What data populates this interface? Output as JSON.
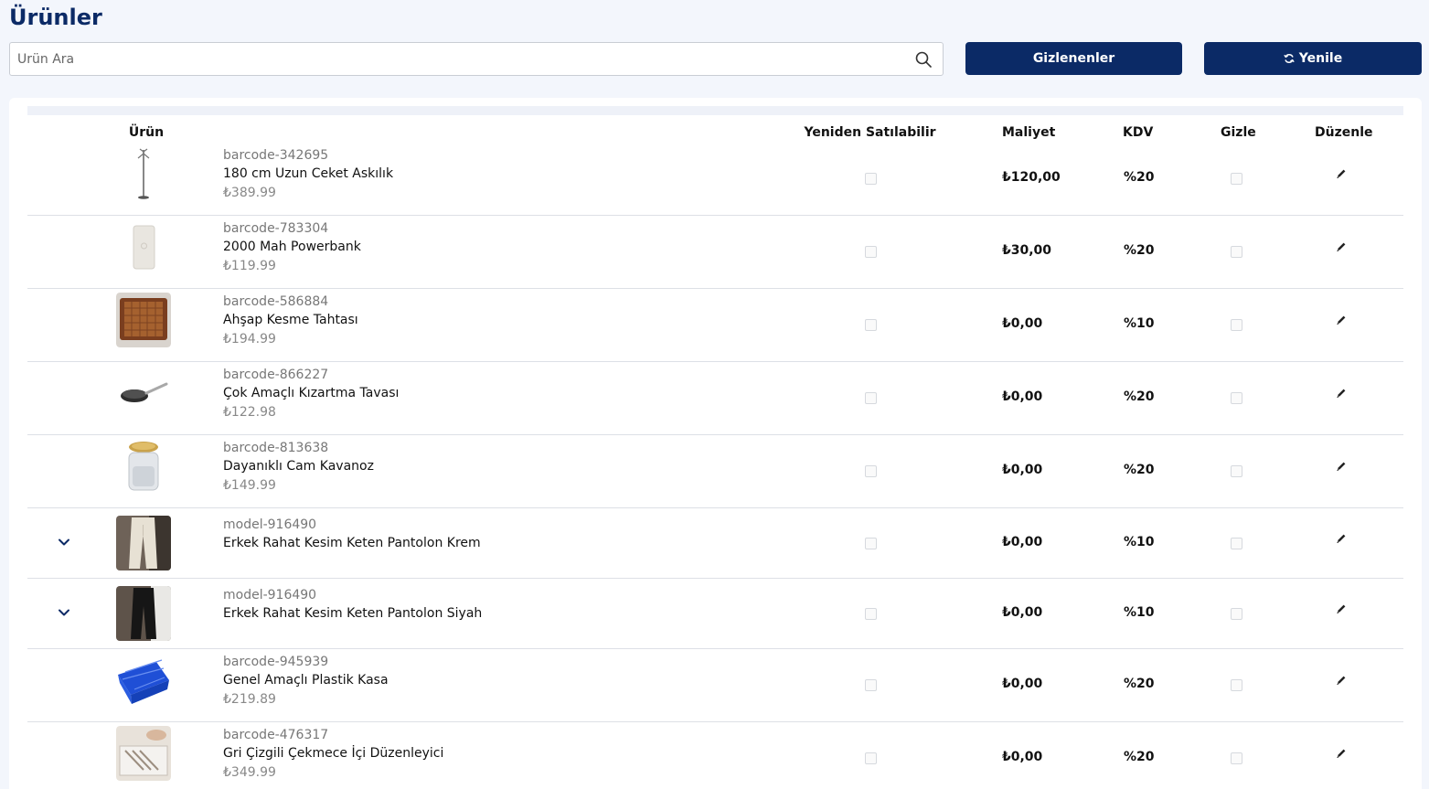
{
  "page": {
    "title": "Ürünler"
  },
  "search": {
    "placeholder": "Ürün Ara"
  },
  "buttons": {
    "hidden_label": "Gizlenenler",
    "refresh_label": "Yenile"
  },
  "table": {
    "headers": {
      "product": "Ürün",
      "resellable": "Yeniden Satılabilir",
      "cost": "Maliyet",
      "vat": "KDV",
      "hide": "Gizle",
      "edit": "Düzenle"
    },
    "rows": [
      {
        "code": "barcode-342695",
        "name": "180 cm Uzun Ceket Askılık",
        "price": "₺389.99",
        "cost": "₺120,00",
        "vat": "%20",
        "image": "coat-rack"
      },
      {
        "code": "barcode-783304",
        "name": "2000 Mah Powerbank",
        "price": "₺119.99",
        "cost": "₺30,00",
        "vat": "%20",
        "image": "powerbank"
      },
      {
        "code": "barcode-586884",
        "name": "Ahşap Kesme Tahtası",
        "price": "₺194.99",
        "cost": "₺0,00",
        "vat": "%10",
        "image": "cutting-board"
      },
      {
        "code": "barcode-866227",
        "name": "Çok Amaçlı Kızartma Tavası",
        "price": "₺122.98",
        "cost": "₺0,00",
        "vat": "%20",
        "image": "frying-pan"
      },
      {
        "code": "barcode-813638",
        "name": "Dayanıklı Cam Kavanoz",
        "price": "₺149.99",
        "cost": "₺0,00",
        "vat": "%20",
        "image": "glass-jar"
      },
      {
        "code": "model-916490",
        "name": "Erkek Rahat Kesim Keten Pantolon Krem",
        "price": "",
        "cost": "₺0,00",
        "vat": "%10",
        "image": "cream-trousers",
        "expandable": true
      },
      {
        "code": "model-916490",
        "name": "Erkek Rahat Kesim Keten Pantolon Siyah",
        "price": "",
        "cost": "₺0,00",
        "vat": "%10",
        "image": "black-trousers",
        "expandable": true
      },
      {
        "code": "barcode-945939",
        "name": "Genel Amaçlı Plastik Kasa",
        "price": "₺219.89",
        "cost": "₺0,00",
        "vat": "%20",
        "image": "plastic-crate"
      },
      {
        "code": "barcode-476317",
        "name": "Gri Çizgili Çekmece İçi Düzenleyici",
        "price": "₺349.99",
        "cost": "₺0,00",
        "vat": "%20",
        "image": "drawer-organizer"
      }
    ]
  },
  "colors": {
    "primary": "#0b2a66",
    "background": "#f3f6fc"
  }
}
